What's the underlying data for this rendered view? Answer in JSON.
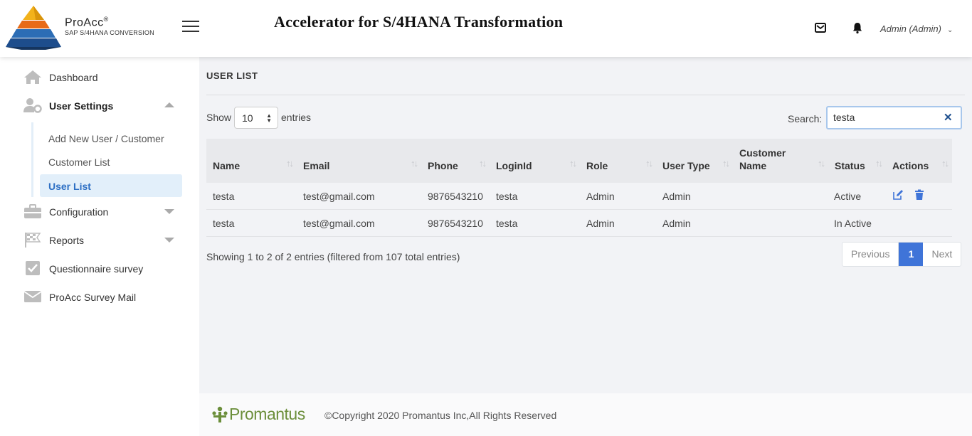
{
  "brand": {
    "name": "ProAcc",
    "reg": "®",
    "subtitle": "SAP S/4HANA CONVERSION"
  },
  "header": {
    "title": "Accelerator for S/4HANA Transformation",
    "user": "Admin (Admin)"
  },
  "sidebar": {
    "items": [
      {
        "label": "Dashboard",
        "icon": "home-icon"
      },
      {
        "label": "User Settings",
        "icon": "user-settings-icon"
      },
      {
        "label": "Configuration",
        "icon": "briefcase-icon"
      },
      {
        "label": "Reports",
        "icon": "flag-icon"
      },
      {
        "label": "Questionnaire survey",
        "icon": "checkbox-icon"
      },
      {
        "label": "ProAcc Survey Mail",
        "icon": "envelope-icon"
      }
    ],
    "submenu": [
      {
        "label": "Add New User / Customer"
      },
      {
        "label": "Customer List"
      },
      {
        "label": "User List"
      }
    ]
  },
  "main": {
    "heading": "USER LIST",
    "show_label": "Show",
    "entries_value": "10",
    "entries_label": "entries",
    "search_label": "Search:",
    "search_value": "testa",
    "columns": [
      "Name",
      "Email",
      "Phone",
      "LoginId",
      "Role",
      "User Type",
      "Customer Name",
      "Status",
      "Actions"
    ],
    "rows": [
      {
        "name": "testa",
        "email": "test@gmail.com",
        "phone": "9876543210",
        "loginid": "testa",
        "role": "Admin",
        "user_type": "Admin",
        "customer_name": "",
        "status": "Active"
      },
      {
        "name": "testa",
        "email": "test@gmail.com",
        "phone": "9876543210",
        "loginid": "testa",
        "role": "Admin",
        "user_type": "Admin",
        "customer_name": "",
        "status": "In Active"
      }
    ],
    "info": "Showing 1 to 2 of 2 entries (filtered from 107 total entries)",
    "pagination": {
      "previous": "Previous",
      "current": "1",
      "next": "Next"
    }
  },
  "footer": {
    "logo_text": "Promantus",
    "copyright": "©Copyright 2020 Promantus Inc,All Rights Reserved"
  },
  "colors": {
    "accent": "#3f74d8",
    "active_bg": "#e2effa",
    "active_text": "#2d6fc4",
    "footer_logo": "#6b8e3a"
  }
}
